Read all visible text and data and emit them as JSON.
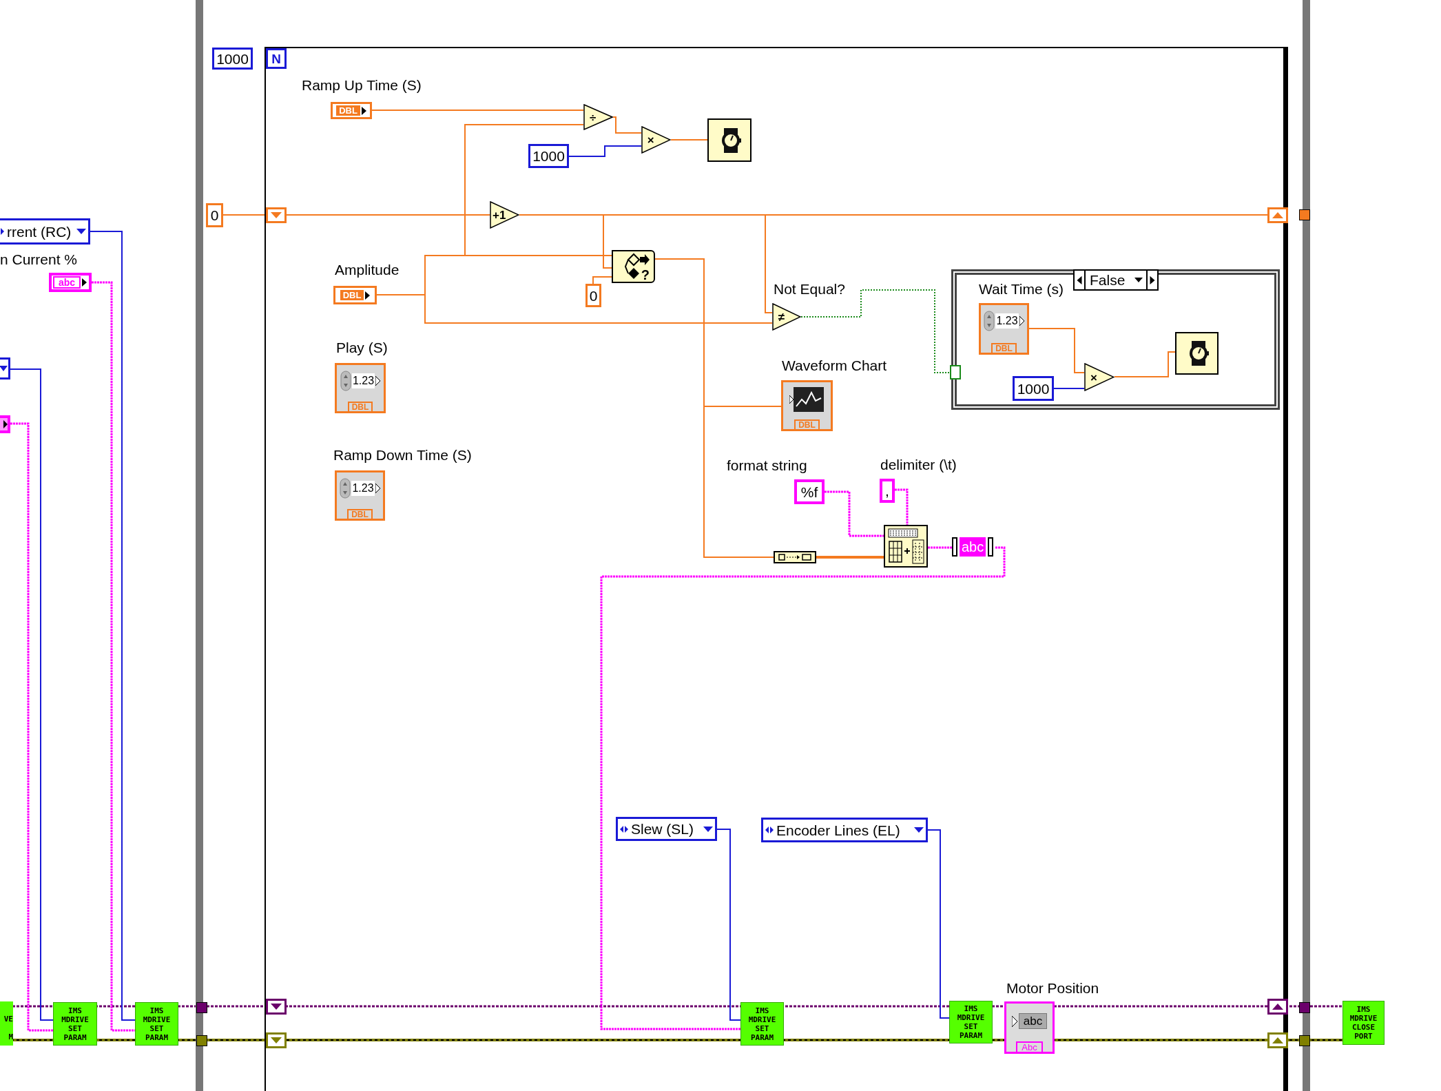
{
  "left_section": {
    "ring_constant": "rrent (RC)",
    "current_label": "n Current %",
    "string_constant": "abc",
    "subvis": [
      {
        "kind": "subvi_cut",
        "lines": [
          "VE",
          "M"
        ]
      },
      {
        "kind": "subvi",
        "lines": [
          "IMS",
          "MDRIVE",
          "SET",
          "PARAM"
        ]
      },
      {
        "kind": "subvi",
        "lines": [
          "IMS",
          "MDRIVE",
          "SET",
          "PARAM"
        ]
      }
    ]
  },
  "for_loop": {
    "count": "1000",
    "count_terminal": "N",
    "shift_init": "0",
    "items": [
      {
        "kind": "label",
        "text": "Ramp Up Time (S)"
      },
      {
        "kind": "dbl_terminal",
        "text": "DBL"
      },
      {
        "kind": "primitive",
        "symbol": "÷"
      },
      {
        "kind": "primitive",
        "symbol": "×"
      },
      {
        "kind": "int_constant",
        "text": "1000"
      },
      {
        "kind": "wait_node"
      },
      {
        "kind": "primitive",
        "symbol": "+1"
      },
      {
        "kind": "label",
        "text": "Amplitude"
      },
      {
        "kind": "dbl_terminal",
        "text": "DBL"
      },
      {
        "kind": "select_node",
        "symbol": "?"
      },
      {
        "kind": "dbl_constant",
        "text": "0"
      },
      {
        "kind": "label",
        "text": "Not Equal?"
      },
      {
        "kind": "primitive",
        "symbol": "≠"
      },
      {
        "kind": "label",
        "text": "Play (S)"
      },
      {
        "kind": "numeric_control",
        "value": "1.23",
        "type": "DBL"
      },
      {
        "kind": "label",
        "text": "Ramp Down Time (S)"
      },
      {
        "kind": "numeric_control",
        "value": "1.23",
        "type": "DBL"
      },
      {
        "kind": "label",
        "text": "Waveform Chart"
      },
      {
        "kind": "chart_indicator",
        "type": "DBL"
      },
      {
        "kind": "label",
        "text": "format string"
      },
      {
        "kind": "string_constant",
        "text": "%f"
      },
      {
        "kind": "label",
        "text": "delimiter (\\t)"
      },
      {
        "kind": "string_constant",
        "text": ","
      },
      {
        "kind": "build_array"
      },
      {
        "kind": "spreadsheet_node"
      },
      {
        "kind": "string_indicator",
        "text": "abc"
      },
      {
        "kind": "ring_constant",
        "text": "Slew (SL)"
      },
      {
        "kind": "ring_constant",
        "text": "Encoder Lines (EL)"
      },
      {
        "kind": "subvi",
        "lines": [
          "IMS",
          "MDRIVE",
          "SET",
          "PARAM"
        ]
      },
      {
        "kind": "subvi",
        "lines": [
          "IMS",
          "MDRIVE",
          "SET",
          "PARAM"
        ]
      },
      {
        "kind": "label",
        "text": "Motor Position"
      },
      {
        "kind": "string_display",
        "value": "abc",
        "type": "Abc"
      }
    ],
    "case_structure": {
      "selector": "False",
      "items": [
        {
          "kind": "label",
          "text": "Wait Time (s)"
        },
        {
          "kind": "numeric_control",
          "value": "1.23",
          "type": "DBL"
        },
        {
          "kind": "int_constant",
          "text": "1000"
        },
        {
          "kind": "primitive",
          "symbol": "×"
        },
        {
          "kind": "wait_node"
        }
      ]
    }
  },
  "right_section": {
    "subvi": {
      "kind": "subvi",
      "lines": [
        "IMS",
        "MDRIVE",
        "CLOSE",
        "PORT"
      ]
    }
  }
}
